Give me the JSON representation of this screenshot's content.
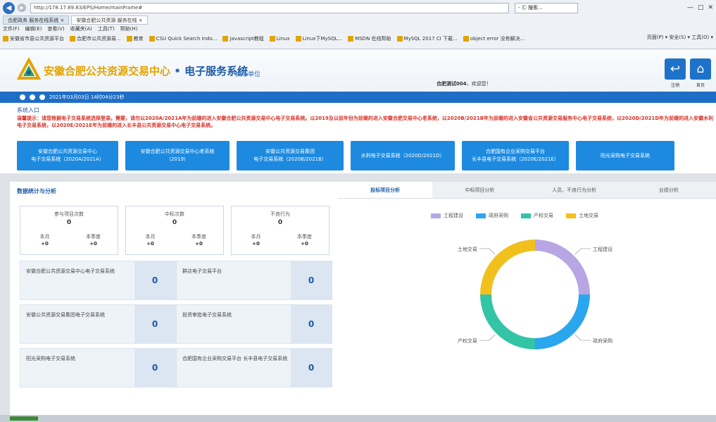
{
  "browser": {
    "address": "http://178.17.89.83/EPS/Home/mainFrame#",
    "search": "- Ⓒ 搜索...",
    "window_controls": [
      "—",
      "□",
      "✕"
    ],
    "tabs": [
      "合肥政务 服务在线系统 ×",
      "安徽合肥公共资源 服务在线 ×"
    ],
    "menu": [
      "文件(F)",
      "编辑(E)",
      "查看(V)",
      "收藏夹(A)",
      "工具(T)",
      "帮助(H)"
    ],
    "favorites": [
      "安徽省市县公共资源平台",
      "合肥市公共资源易...",
      "教育",
      "CSU Quick Search Indo...",
      "Javascript教程",
      "Linux",
      "Linux下MySQL...",
      "MSDN 在线帮助",
      "MySQL 2017 CI 下载...",
      "object error 没有解决..."
    ],
    "fav_right": "页面(P) ▾ 安全(S) ▾ 工具(O) ▾"
  },
  "header": {
    "title_main": "安徽合肥公共资源交易中心",
    "title_dot": " • ",
    "title_sys": "电子服务系统",
    "role": "投标单位",
    "user_name": "合肥测试004",
    "user_greeting": "，欢迎您！",
    "btn_logout": "注销",
    "btn_home": "首页"
  },
  "info_bar": {
    "text": "2021年03月03日 14时04分23秒"
  },
  "entry": {
    "title": "系统入口",
    "notice": "温馨提示：请您根据电子交易系统选择登录。需要，请勿以2020A/2021A年为前缀的进入安徽合肥公共资源交易中心电子交易系统。以2019及以前年份为前缀的进入安徽合肥交易中心老系统，以2020B/2021B年为前缀的进入安徽省公共资源交易服务中心电子交易系统，以2020D/2021D年为前缀的进入安徽水利电子交易系统，以2020E/2021E年为前缀的进入长丰县公共资源交易中心电子交易系统。",
    "buttons": [
      "安徽合肥公共资源交易中心\n电子交易系统（2020A/2021A）",
      "安徽合肥公共资源交易中心老系统\n（2019）",
      "安徽公共资源交易集团\n电子交易系统（2020B/2021B）",
      "水利电子交易系统（2020D/2021D）",
      "合肥国有企业采购交易平台\n长丰县电子交易系统（2020E/2021E）",
      "阳光采购电子交易系统"
    ]
  },
  "stats": {
    "section_title": "数据统计与分析",
    "cards": [
      {
        "label": "参与项目次数",
        "value": "0",
        "sub1_label": "本月",
        "sub1_value": "+0",
        "sub2_label": "本季度",
        "sub2_value": "+0"
      },
      {
        "label": "中标次数",
        "value": "0",
        "sub1_label": "本月",
        "sub1_value": "+0",
        "sub2_label": "本季度",
        "sub2_value": "+0"
      },
      {
        "label": "不良行为",
        "value": "0",
        "sub1_label": "本月",
        "sub1_value": "+0",
        "sub2_label": "本季度",
        "sub2_value": "+0"
      }
    ],
    "platforms": [
      {
        "name": "安徽合肥公共资源交易中心电子交易系统",
        "count": "0"
      },
      {
        "name": "群达电子交易平台",
        "count": "0"
      },
      {
        "name": "安徽公共资源交易集团电子交易系统",
        "count": "0"
      },
      {
        "name": "投资审批电子交易系统",
        "count": "0"
      },
      {
        "name": "阳光采购电子交易系统",
        "count": "0"
      },
      {
        "name": "合肥国有企业采购交易平台 长丰县电子交易系统",
        "count": "0"
      }
    ]
  },
  "analysis": {
    "tabs": [
      "投标项目分析",
      "中标项目分析",
      "人员、不良行为分析",
      "业绩分析"
    ],
    "active_tab": 0,
    "legend": [
      {
        "name": "工程建设",
        "color": "#b7a6e3"
      },
      {
        "name": "政府采购",
        "color": "#2aa6ef"
      },
      {
        "name": "产权交易",
        "color": "#32c4a5"
      },
      {
        "name": "土地交易",
        "color": "#f2c01d"
      }
    ]
  },
  "chart_data": {
    "type": "pie",
    "categories": [
      "工程建设",
      "政府采购",
      "产权交易",
      "土地交易"
    ],
    "values": [
      1,
      1,
      1,
      1
    ],
    "colors": [
      "#b7a6e3",
      "#2aa6ef",
      "#32c4a5",
      "#f2c01d"
    ],
    "legend_position": "top"
  }
}
